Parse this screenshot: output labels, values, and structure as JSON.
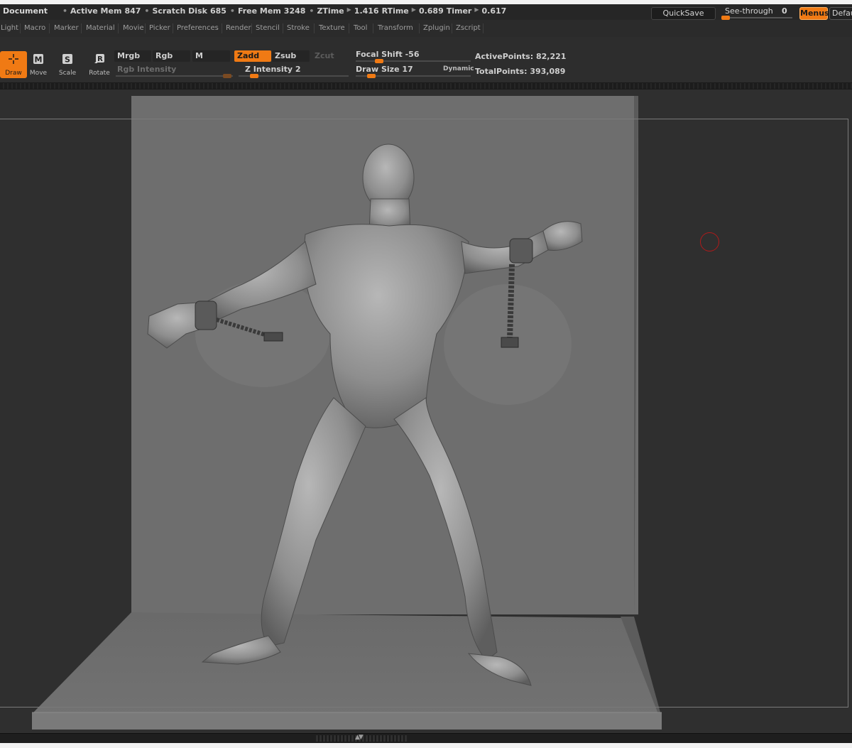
{
  "titlebar": {
    "document_label": "Document",
    "stats": [
      {
        "label": "Active Mem",
        "value": "847"
      },
      {
        "label": "Scratch Disk",
        "value": "685"
      },
      {
        "label": "Free Mem",
        "value": "3248"
      }
    ],
    "timing": [
      {
        "label": "ZTime",
        "value": "1.416"
      },
      {
        "label": "RTime",
        "value": "0.689"
      },
      {
        "label": "Timer",
        "value": "0.617"
      }
    ],
    "quicksave_label": "QuickSave",
    "seethrough_label": "See-through",
    "seethrough_value": "0",
    "menus_label": "Menus",
    "default_label": "DefaultZScript"
  },
  "menubar": {
    "items": [
      "Light",
      "Macro",
      "Marker",
      "Material",
      "Movie",
      "Picker",
      "Preferences",
      "Render",
      "Stencil",
      "Stroke",
      "Texture",
      "Tool",
      "Transform",
      "Zplugin",
      "Zscript"
    ]
  },
  "toolbar": {
    "tools": [
      {
        "label": "Draw",
        "key": "",
        "active": true
      },
      {
        "label": "Move",
        "key": "M",
        "active": false
      },
      {
        "label": "Scale",
        "key": "S",
        "active": false
      },
      {
        "label": "Rotate",
        "key": "R",
        "active": false
      }
    ],
    "mrgb": "Mrgb",
    "rgb": "Rgb",
    "m": "M",
    "zadd": "Zadd",
    "zsub": "Zsub",
    "zcut": "Zcut",
    "rgb_intensity_label": "Rgb Intensity",
    "z_intensity_label": "Z Intensity",
    "z_intensity_value": "2",
    "focal_shift_label": "Focal Shift",
    "focal_shift_value": "-56",
    "draw_size_label": "Draw Size",
    "draw_size_value": "17",
    "dynamic_label": "Dynamic",
    "active_points_label": "ActivePoints:",
    "active_points_value": "82,221",
    "total_points_label": "TotalPoints:",
    "total_points_value": "393,089"
  },
  "colors": {
    "accent": "#f07a14",
    "panel": "#2d2d2d",
    "canvas": "#2f2f2f",
    "backdrop": "#6e6e6e",
    "brush_cursor": "#b01a1a"
  },
  "icons": {
    "draw": "crosshair-icon",
    "move": "move-icon",
    "scale": "scale-icon",
    "rotate": "rotate-icon"
  }
}
